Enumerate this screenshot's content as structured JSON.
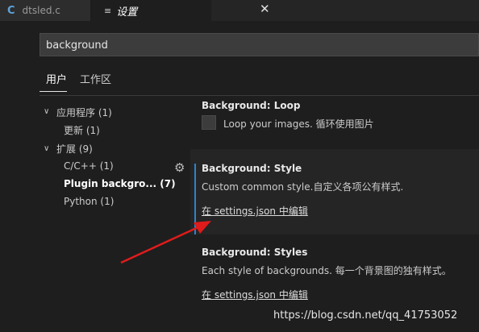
{
  "tabs": [
    {
      "icon": "c-file-icon",
      "icon_glyph": "C",
      "label": "dtsled.c",
      "active": false
    },
    {
      "icon": "settings-icon",
      "icon_glyph": "≡",
      "label": "设置",
      "active": true,
      "close_glyph": "✕"
    }
  ],
  "search": {
    "value": "background"
  },
  "scopes": {
    "user": "用户",
    "workspace": "工作区"
  },
  "toc": [
    {
      "label": "应用程序 (1)",
      "expanded": true
    },
    {
      "label": "更新 (1)"
    },
    {
      "label": "扩展 (9)",
      "expanded": true
    },
    {
      "label": "C/C++ (1)"
    },
    {
      "label": "Plugin backgro... (7)",
      "selected": true
    },
    {
      "label": "Python (1)"
    }
  ],
  "settings": [
    {
      "title": "Background: Loop",
      "description": "Loop your images. 循环使用图片"
    },
    {
      "title": "Background: Style",
      "description": "Custom common style.自定义各项公有样式.",
      "link": "在 settings.json 中编辑"
    },
    {
      "title": "Background: Styles",
      "description": "Each style of backgrounds. 每一个背景图的独有样式。",
      "link": "在 settings.json 中编辑"
    }
  ],
  "watermark": "https://blog.csdn.net/qq_41753052",
  "colors": {
    "accent": "#2f83c9",
    "arrow": "#e01b1b",
    "background": "#1e1e1e"
  },
  "icons": {
    "gear": "gear-icon",
    "chevron": "chevron-down-icon"
  }
}
